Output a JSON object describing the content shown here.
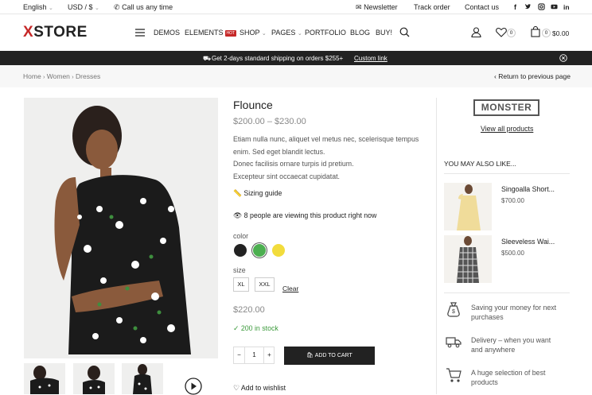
{
  "topbar": {
    "language": "English",
    "currency": "USD / $",
    "call": "Call us any time",
    "newsletter": "Newsletter",
    "track": "Track order",
    "contact": "Contact us"
  },
  "header": {
    "logo_x": "X",
    "logo_rest": "STORE",
    "nav": {
      "demos": "DEMOS",
      "elements": "ELEMENTS",
      "hot": "HOT",
      "shop": "SHOP",
      "pages": "PAGES",
      "portfolio": "PORTFOLIO",
      "blog": "BLOG",
      "buy": "BUY!"
    },
    "wishlist_count": "0",
    "cart_count": "0",
    "cart_total": "$0.00"
  },
  "promo": {
    "text": "Get 2-days standard shipping on orders $255+",
    "link": "Custom link"
  },
  "breadcrumb": {
    "home": "Home",
    "women": "Women",
    "dresses": "Dresses",
    "back": "Return to previous page"
  },
  "product": {
    "title": "Flounce",
    "price_range": "$200.00 – $230.00",
    "desc1": "Etiam nulla nunc, aliquet vel metus nec, scelerisque tempus",
    "desc2": "enim. Sed eget blandit lectus.",
    "desc3": "Donec facilisis ornare turpis id pretium.",
    "desc4": "Excepteur sint occaecat cupidatat.",
    "sizing_guide": "Sizing guide",
    "viewing": "8 people are viewing this product right now",
    "color_label": "color",
    "size_label": "size",
    "size_xl": "XL",
    "size_xxl": "XXL",
    "clear": "Clear",
    "price": "$220.00",
    "stock": "200 in stock",
    "qty": "1",
    "qty_minus": "−",
    "qty_plus": "+",
    "add_to_cart": "ADD TO CART",
    "wishlist": "Add to wishlist",
    "colors": [
      "#222222",
      "#4caf50",
      "#f2dc3c"
    ]
  },
  "sidebar": {
    "brand": "MONSTER",
    "view_all": "View all products",
    "also_like": "YOU MAY ALSO LIKE...",
    "related": [
      {
        "name": "Singoalla Short...",
        "price": "$700.00"
      },
      {
        "name": "Sleeveless Wai...",
        "price": "$500.00"
      }
    ],
    "features": [
      {
        "l1": "Saving your money for next",
        "l2": "purchases",
        "icon": "money-bag-icon"
      },
      {
        "l1": "Delivery – when you want",
        "l2": "and anywhere",
        "icon": "truck-icon"
      },
      {
        "l1": "A huge selection of best",
        "l2": "products",
        "icon": "cart-icon"
      }
    ]
  }
}
